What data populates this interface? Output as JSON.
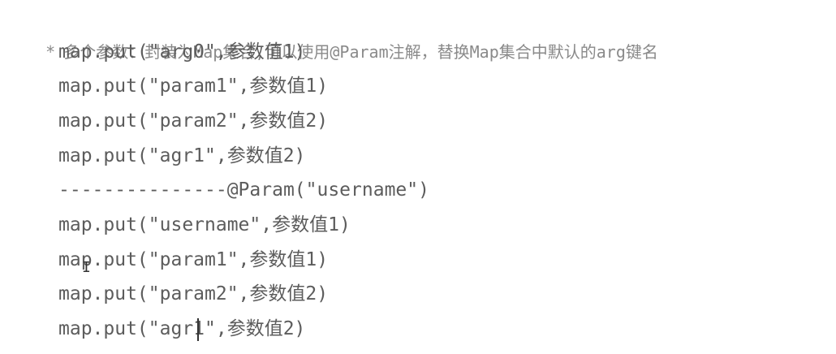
{
  "comment_header": {
    "star": "*",
    "text": "多个参数：封装为Map集合,可以使用@Param注解，替换Map集合中默认的arg键名"
  },
  "code_lines": [
    "map.put(\"arg0\",参数值1)",
    "map.put(\"param1\",参数值1)",
    "map.put(\"param2\",参数值2)",
    "map.put(\"agr1\",参数值2)",
    "---------------@Param(\"username\")",
    "map.put(\"username\",参数值1)",
    "map.put(\"param1\",参数值1)",
    "map.put(\"param2\",参数值2)",
    "map.put(\"agr1\",参数值2)"
  ],
  "cursor_icon": "text-cursor-ibeam-icon"
}
